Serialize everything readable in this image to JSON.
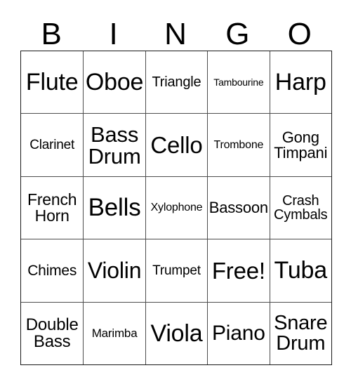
{
  "card": {
    "title": "BINGO",
    "header_letters": [
      "B",
      "I",
      "N",
      "G",
      "O"
    ],
    "grid_size": "5x5",
    "free_space_label": "Free!",
    "free_space_position": "row4-col4",
    "text_color": "#000000",
    "border_color": "#1a1a1a",
    "grid_line_color": "#4d4d4d",
    "background_color": "#ffffff",
    "rows": [
      [
        {
          "text": "Flute",
          "lines": [
            "Flute"
          ],
          "font_size": 34
        },
        {
          "text": "Oboe",
          "lines": [
            "Oboe"
          ],
          "font_size": 34
        },
        {
          "text": "Triangle",
          "lines": [
            "Triangle"
          ],
          "font_size": 20
        },
        {
          "text": "Tambourine",
          "lines": [
            "Tambourine"
          ],
          "font_size": 14
        },
        {
          "text": "Harp",
          "lines": [
            "Harp"
          ],
          "font_size": 34
        }
      ],
      [
        {
          "text": "Clarinet",
          "lines": [
            "Clarinet"
          ],
          "font_size": 19
        },
        {
          "text": "Bass Drum",
          "lines": [
            "Bass",
            "Drum"
          ],
          "font_size": 31
        },
        {
          "text": "Cello",
          "lines": [
            "Cello"
          ],
          "font_size": 33
        },
        {
          "text": "Trombone",
          "lines": [
            "Trombone"
          ],
          "font_size": 16
        },
        {
          "text": "Gong Timpani",
          "lines": [
            "Gong",
            "Timpani"
          ],
          "font_size": 22
        }
      ],
      [
        {
          "text": "French Horn",
          "lines": [
            "French",
            "Horn"
          ],
          "font_size": 23
        },
        {
          "text": "Bells",
          "lines": [
            "Bells"
          ],
          "font_size": 35
        },
        {
          "text": "Xylophone",
          "lines": [
            "Xylophone"
          ],
          "font_size": 16
        },
        {
          "text": "Bassoon",
          "lines": [
            "Bassoon"
          ],
          "font_size": 22
        },
        {
          "text": "Crash Cymbals",
          "lines": [
            "Crash",
            "Cymbals"
          ],
          "font_size": 20
        }
      ],
      [
        {
          "text": "Chimes",
          "lines": [
            "Chimes"
          ],
          "font_size": 21
        },
        {
          "text": "Violin",
          "lines": [
            "Violin"
          ],
          "font_size": 32
        },
        {
          "text": "Trumpet",
          "lines": [
            "Trumpet"
          ],
          "font_size": 19
        },
        {
          "text": "Free!",
          "lines": [
            "Free!"
          ],
          "font_size": 33
        },
        {
          "text": "Tuba",
          "lines": [
            "Tuba"
          ],
          "font_size": 34
        }
      ],
      [
        {
          "text": "Double Bass",
          "lines": [
            "Double",
            "Bass"
          ],
          "font_size": 24
        },
        {
          "text": "Marimba",
          "lines": [
            "Marimba"
          ],
          "font_size": 17
        },
        {
          "text": "Viola",
          "lines": [
            "Viola"
          ],
          "font_size": 34
        },
        {
          "text": "Piano",
          "lines": [
            "Piano"
          ],
          "font_size": 30
        },
        {
          "text": "Snare Drum",
          "lines": [
            "Snare",
            "Drum"
          ],
          "font_size": 29
        }
      ]
    ]
  }
}
